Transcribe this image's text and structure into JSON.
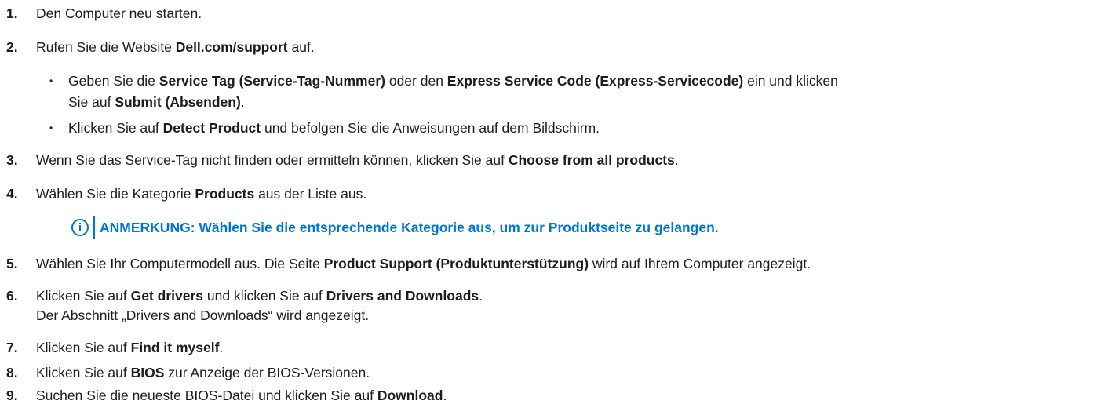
{
  "steps": {
    "s1": {
      "num": "1.",
      "text": "Den Computer neu starten."
    },
    "s2": {
      "num": "2.",
      "a": "Rufen Sie die Website ",
      "b": "Dell.com/support",
      "c": " auf."
    },
    "sub1": {
      "bullet": "•",
      "a": "Geben Sie die ",
      "b": "Service Tag (Service-Tag-Nummer)",
      "c": " oder den ",
      "d": "Express Service Code (Express-Servicecode)",
      "e": " ein und klicken",
      "f": "Sie auf ",
      "g": "Submit (Absenden)",
      "h": "."
    },
    "sub2": {
      "bullet": "•",
      "a": "Klicken Sie auf ",
      "b": "Detect Product",
      "c": " und befolgen Sie die Anweisungen auf dem Bildschirm."
    },
    "s3": {
      "num": "3.",
      "a": "Wenn Sie das Service-Tag nicht finden oder ermitteln können, klicken Sie auf ",
      "b": "Choose from all products",
      "c": "."
    },
    "s4": {
      "num": "4.",
      "a": "Wählen Sie die Kategorie ",
      "b": "Products",
      "c": " aus der Liste aus."
    },
    "note": {
      "icon": "info-icon",
      "icon_glyph": "i",
      "label": "ANMERKUNG: ",
      "text": "Wählen Sie die entsprechende Kategorie aus, um zur Produktseite zu gelangen.",
      "color": "#0076ce"
    },
    "s5": {
      "num": "5.",
      "a": "Wählen Sie Ihr Computermodell aus. Die Seite ",
      "b": "Product Support (Produktunterstützung)",
      "c": " wird auf Ihrem Computer angezeigt."
    },
    "s6": {
      "num": "6.",
      "a": "Klicken Sie auf ",
      "b": "Get drivers",
      "c": " und klicken Sie auf ",
      "d": "Drivers and Downloads",
      "e": ".",
      "line2": "Der Abschnitt „Drivers and Downloads“ wird angezeigt."
    },
    "s7": {
      "num": "7.",
      "a": "Klicken Sie auf ",
      "b": "Find it myself",
      "c": "."
    },
    "s8": {
      "num": "8.",
      "a": "Klicken Sie auf ",
      "b": "BIOS",
      "c": " zur Anzeige der BIOS-Versionen."
    },
    "s9": {
      "num": "9.",
      "a": "Suchen Sie die neueste BIOS-Datei und klicken Sie auf ",
      "b": "Download",
      "c": "."
    }
  }
}
